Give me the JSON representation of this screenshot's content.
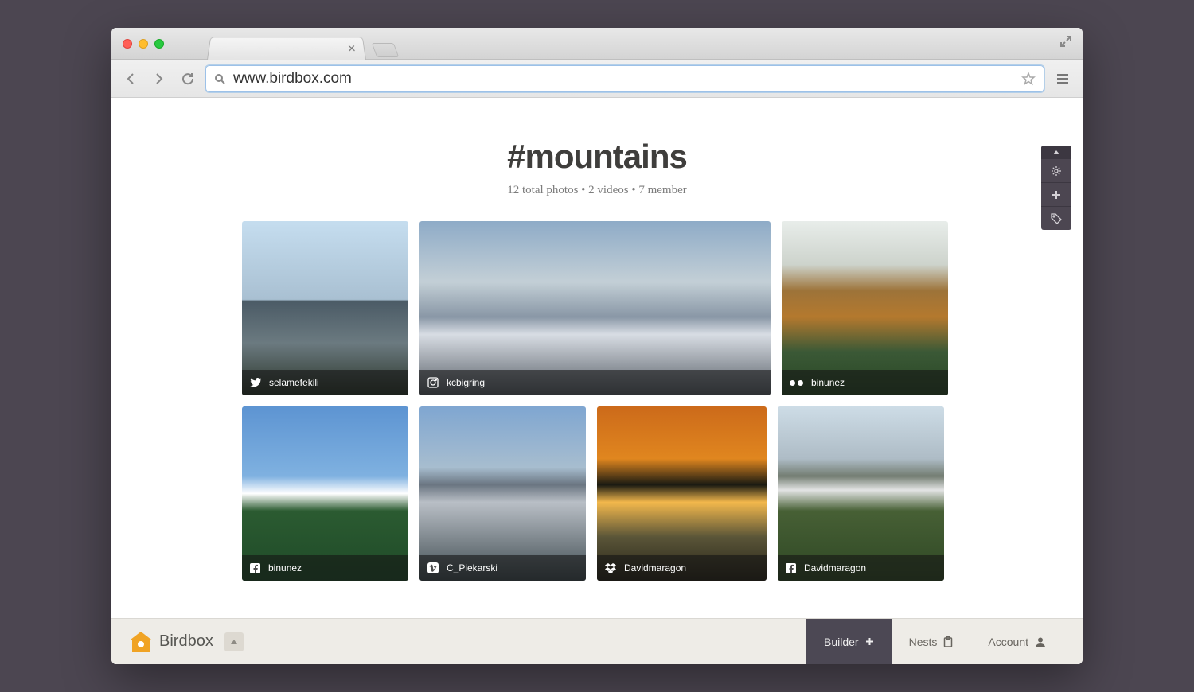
{
  "browser": {
    "url": "www.birdbox.com"
  },
  "page": {
    "title": "#mountains",
    "subtitle": "12 total photos  •  2 videos  •  7 member"
  },
  "photos": [
    {
      "user": "selamefekili",
      "source": "twitter"
    },
    {
      "user": "kcbigring",
      "source": "instagram"
    },
    {
      "user": "binunez",
      "source": "flickr"
    },
    {
      "user": "binunez",
      "source": "facebook"
    },
    {
      "user": "C_Piekarski",
      "source": "vimeo"
    },
    {
      "user": "Davidmaragon",
      "source": "dropbox"
    },
    {
      "user": "Davidmaragon",
      "source": "facebook"
    }
  ],
  "bottombar": {
    "brand": "Birdbox",
    "builder": "Builder",
    "nests": "Nests",
    "account": "Account"
  }
}
